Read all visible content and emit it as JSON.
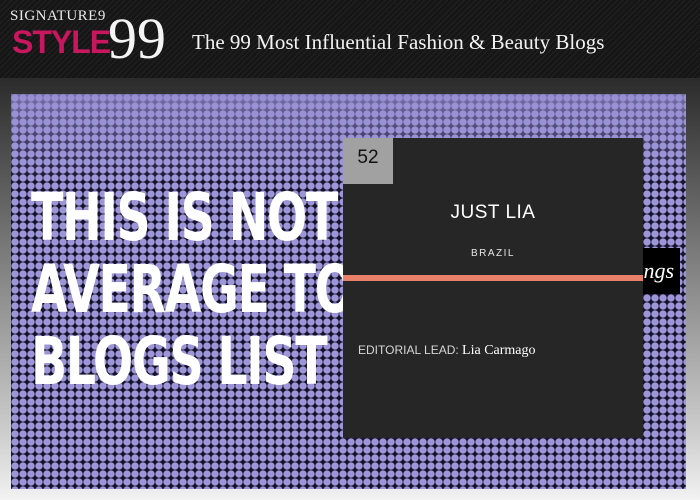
{
  "header": {
    "logo_signature": "SIGNATURE9",
    "logo_style": "STYLE",
    "logo_number": "99",
    "tagline": "The 99 Most Influential Fashion & Beauty Blogs"
  },
  "hero": {
    "headline_lines": [
      "THIS IS NOT Y",
      "AVERAGE TO",
      "BLOGS LIST"
    ],
    "rankings_tag": "ngs"
  },
  "card": {
    "rank": "52",
    "title": "JUST LIA",
    "country": "BRAZIL",
    "lead_label": "EDITORIAL LEAD:",
    "lead_name": "Lia Carmago"
  },
  "colors": {
    "brand_magenta": "#c8165f",
    "card_bg": "#262626",
    "divider": "#e8806a",
    "dot_lavender": "#9c96d8"
  }
}
